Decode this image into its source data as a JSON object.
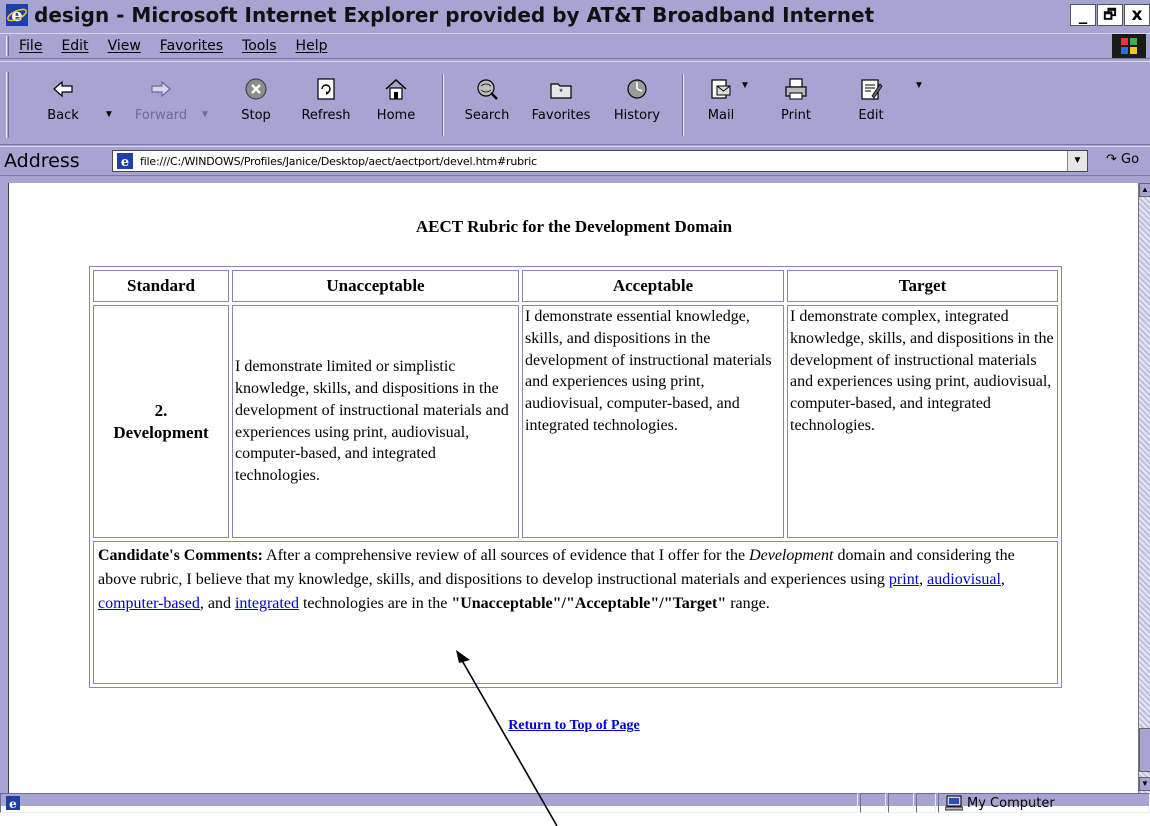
{
  "window": {
    "title": "design - Microsoft Internet Explorer provided by AT&T Broadband Internet",
    "controls": [
      "_",
      "🗗",
      "x"
    ]
  },
  "menu": [
    "File",
    "Edit",
    "View",
    "Favorites",
    "Tools",
    "Help"
  ],
  "toolbar": {
    "back": "Back",
    "forward": "Forward",
    "stop": "Stop",
    "refresh": "Refresh",
    "home": "Home",
    "search": "Search",
    "favorites": "Favorites",
    "history": "History",
    "mail": "Mail",
    "print": "Print",
    "edit": "Edit"
  },
  "address": {
    "label": "Address",
    "url": "file:///C:/WINDOWS/Profiles/Janice/Desktop/aect/aectport/devel.htm#rubric",
    "go": "Go"
  },
  "document": {
    "title": "AECT Rubric for the Development Domain",
    "headers": {
      "standard": "Standard",
      "unacceptable": "Unacceptable",
      "acceptable": "Acceptable",
      "target": "Target"
    },
    "row": {
      "standard_num": "2.",
      "standard_name": "Development",
      "unacceptable": "I demonstrate limited or simplistic knowledge, skills, and dispositions in the development of instructional materials and experiences using print, audiovisual, computer-based, and integrated technologies.",
      "acceptable": "I demonstrate essential knowledge, skills, and dispositions in the development of instructional materials and experiences using print, audiovisual, computer-based, and integrated technologies.",
      "target": "I demonstrate complex, integrated knowledge, skills, and dispositions in the development of instructional materials and experiences using print, audiovisual, computer-based, and integrated technologies."
    },
    "comments": {
      "label": "Candidate's Comments:",
      "text1": " After a comprehensive review of all sources of evidence that I offer for the ",
      "domain": "Development",
      "text2": " domain and considering the above rubric, I believe that my knowledge, skills, and dispositions to develop instructional materials and experiences using ",
      "link_print": "print",
      "sep1": ", ",
      "link_audiovisual": "audiovisual",
      "sep2": ", ",
      "link_computer": "computer-based",
      "sep3": ", and ",
      "link_integrated": "integrated",
      "text3": " technologies are in the ",
      "range_options": "\"Unacceptable\"/\"Acceptable\"/\"Target\"",
      "text4": " range."
    },
    "return_link": "Return to Top of Page"
  },
  "status": {
    "zone": "My Computer"
  },
  "colors": {
    "chrome": "#a8a4d2",
    "link": "#0000cc",
    "table_border": "#8a86b8"
  }
}
